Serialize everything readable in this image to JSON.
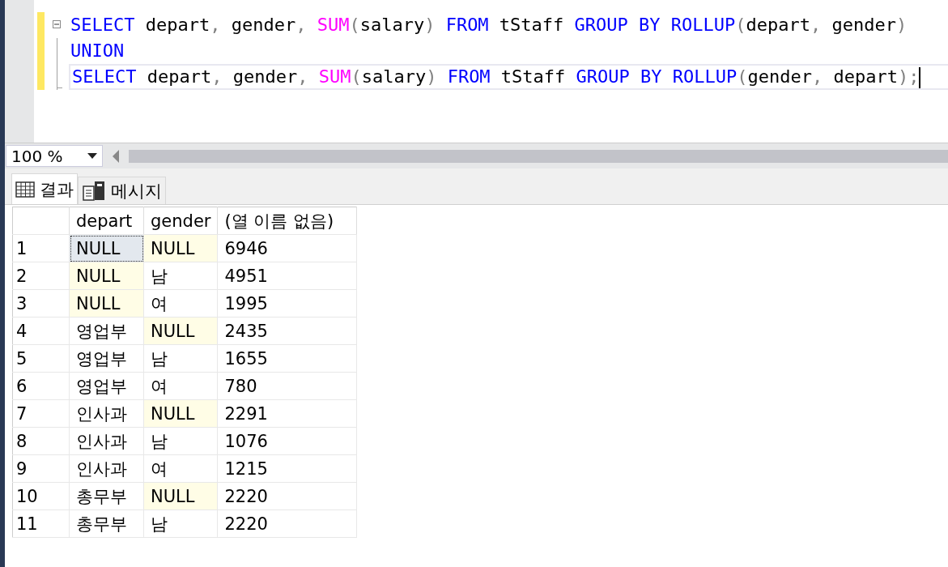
{
  "editor": {
    "lines": [
      {
        "foldable": true,
        "current": false,
        "tokens": [
          {
            "kind": "keyword",
            "text": "SELECT"
          },
          {
            "kind": "text",
            "text": " depart"
          },
          {
            "kind": "punct",
            "text": ","
          },
          {
            "kind": "text",
            "text": " gender"
          },
          {
            "kind": "punct",
            "text": ","
          },
          {
            "kind": "function",
            "text": " SUM"
          },
          {
            "kind": "punct",
            "text": "("
          },
          {
            "kind": "text",
            "text": "salary"
          },
          {
            "kind": "punct",
            "text": ")"
          },
          {
            "kind": "keyword",
            "text": " FROM"
          },
          {
            "kind": "text",
            "text": " tStaff"
          },
          {
            "kind": "keyword",
            "text": " GROUP BY ROLLUP"
          },
          {
            "kind": "punct",
            "text": "("
          },
          {
            "kind": "text",
            "text": "depart"
          },
          {
            "kind": "punct",
            "text": ","
          },
          {
            "kind": "text",
            "text": " gender"
          },
          {
            "kind": "punct",
            "text": ")"
          }
        ]
      },
      {
        "foldable": false,
        "current": false,
        "tokens": [
          {
            "kind": "keyword",
            "text": "UNION"
          }
        ]
      },
      {
        "foldable": false,
        "current": true,
        "tokens": [
          {
            "kind": "keyword",
            "text": "SELECT"
          },
          {
            "kind": "text",
            "text": " depart"
          },
          {
            "kind": "punct",
            "text": ","
          },
          {
            "kind": "text",
            "text": " gender"
          },
          {
            "kind": "punct",
            "text": ","
          },
          {
            "kind": "function",
            "text": " SUM"
          },
          {
            "kind": "punct",
            "text": "("
          },
          {
            "kind": "text",
            "text": "salary"
          },
          {
            "kind": "punct",
            "text": ")"
          },
          {
            "kind": "keyword",
            "text": " FROM"
          },
          {
            "kind": "text",
            "text": " tStaff"
          },
          {
            "kind": "keyword",
            "text": " GROUP BY ROLLUP"
          },
          {
            "kind": "punct",
            "text": "("
          },
          {
            "kind": "text",
            "text": "gender"
          },
          {
            "kind": "punct",
            "text": ","
          },
          {
            "kind": "text",
            "text": " depart"
          },
          {
            "kind": "punct",
            "text": ");"
          }
        ]
      }
    ]
  },
  "zoom": {
    "value": "100 %"
  },
  "tabs": [
    {
      "label": "결과",
      "kind": "results",
      "selected": true
    },
    {
      "label": "메시지",
      "kind": "messages",
      "selected": false
    }
  ],
  "grid": {
    "columns": [
      "depart",
      "gender",
      "(열 이름 없음)"
    ],
    "rows": [
      {
        "number": "1",
        "cells": [
          {
            "text": "NULL",
            "selected": true,
            "highlighted": true
          },
          {
            "text": "NULL",
            "selected": false,
            "highlighted": true
          },
          {
            "text": "6946",
            "selected": false,
            "highlighted": false
          }
        ]
      },
      {
        "number": "2",
        "cells": [
          {
            "text": "NULL",
            "selected": false,
            "highlighted": true
          },
          {
            "text": "남",
            "selected": false,
            "highlighted": false
          },
          {
            "text": "4951",
            "selected": false,
            "highlighted": false
          }
        ]
      },
      {
        "number": "3",
        "cells": [
          {
            "text": "NULL",
            "selected": false,
            "highlighted": true
          },
          {
            "text": "여",
            "selected": false,
            "highlighted": false
          },
          {
            "text": "1995",
            "selected": false,
            "highlighted": false
          }
        ]
      },
      {
        "number": "4",
        "cells": [
          {
            "text": "영업부",
            "selected": false,
            "highlighted": false
          },
          {
            "text": "NULL",
            "selected": false,
            "highlighted": true
          },
          {
            "text": "2435",
            "selected": false,
            "highlighted": false
          }
        ]
      },
      {
        "number": "5",
        "cells": [
          {
            "text": "영업부",
            "selected": false,
            "highlighted": false
          },
          {
            "text": "남",
            "selected": false,
            "highlighted": false
          },
          {
            "text": "1655",
            "selected": false,
            "highlighted": false
          }
        ]
      },
      {
        "number": "6",
        "cells": [
          {
            "text": "영업부",
            "selected": false,
            "highlighted": false
          },
          {
            "text": "여",
            "selected": false,
            "highlighted": false
          },
          {
            "text": "780",
            "selected": false,
            "highlighted": false
          }
        ]
      },
      {
        "number": "7",
        "cells": [
          {
            "text": "인사과",
            "selected": false,
            "highlighted": false
          },
          {
            "text": "NULL",
            "selected": false,
            "highlighted": true
          },
          {
            "text": "2291",
            "selected": false,
            "highlighted": false
          }
        ]
      },
      {
        "number": "8",
        "cells": [
          {
            "text": "인사과",
            "selected": false,
            "highlighted": false
          },
          {
            "text": "남",
            "selected": false,
            "highlighted": false
          },
          {
            "text": "1076",
            "selected": false,
            "highlighted": false
          }
        ]
      },
      {
        "number": "9",
        "cells": [
          {
            "text": "인사과",
            "selected": false,
            "highlighted": false
          },
          {
            "text": "여",
            "selected": false,
            "highlighted": false
          },
          {
            "text": "1215",
            "selected": false,
            "highlighted": false
          }
        ]
      },
      {
        "number": "10",
        "cells": [
          {
            "text": "총무부",
            "selected": false,
            "highlighted": false
          },
          {
            "text": "NULL",
            "selected": false,
            "highlighted": true
          },
          {
            "text": "2220",
            "selected": false,
            "highlighted": false
          }
        ]
      },
      {
        "number": "11",
        "cells": [
          {
            "text": "총무부",
            "selected": false,
            "highlighted": false
          },
          {
            "text": "남",
            "selected": false,
            "highlighted": false
          },
          {
            "text": "2220",
            "selected": false,
            "highlighted": false
          }
        ]
      }
    ]
  }
}
